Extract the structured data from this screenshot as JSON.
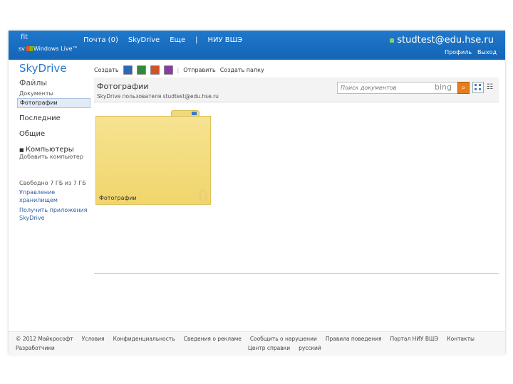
{
  "header": {
    "brand_small": "fit",
    "logo_prefix": "sv",
    "logo_text": "Windows Live",
    "logo_tm": "™",
    "nav": [
      "Почта (0)",
      "SkyDrive",
      "Еще",
      "|",
      "НИУ ВШЭ"
    ],
    "user_email": "studtest@edu.hse.ru",
    "user_links": [
      "Профиль",
      "Выход"
    ]
  },
  "app": {
    "title": "SkyDrive"
  },
  "toolbar": {
    "create_label": "Создать",
    "icons": [
      "word-icon",
      "excel-icon",
      "powerpoint-icon",
      "onenote-icon"
    ],
    "separator": "|",
    "upload_label": "Отправить",
    "create_folder_label": "Создать папку"
  },
  "sidebar": {
    "files_heading": "Файлы",
    "files_items": [
      "Документы",
      "Фотографии"
    ],
    "selected_item": "Фотографии",
    "recent_label": "Последние",
    "shared_label": "Общие",
    "computers_label": "Компьютеры",
    "add_computer_label": "Добавить компьютер",
    "storage_text": "Свободно 7 ГБ из 7 ГБ",
    "manage_storage_label": "Управление хранилищем",
    "get_app_label": "Получить приложения SkyDrive"
  },
  "content": {
    "folder_title": "Фотографии",
    "owner_text": "SkyDrive пользователя studtest@edu.hse.ru",
    "search_placeholder": "Поиск документов",
    "search_brand": "bing",
    "tiles": [
      {
        "name": "Фотографии",
        "count": "0"
      }
    ]
  },
  "footer": {
    "row1": [
      "© 2012 Майкрософт",
      "Условия",
      "Конфиденциальность",
      "Сведения о рекламе",
      "Сообщить о нарушении",
      "Правила поведения",
      "Портал НИУ ВШЭ",
      "Контакты"
    ],
    "row2_left": "Разработчики",
    "row2_right": [
      "Центр справки",
      "русский"
    ]
  },
  "colors": {
    "header_blue": "#1a6fc1",
    "accent_blue": "#2b77c5",
    "folder_yellow": "#f3dc7f",
    "search_orange": "#e57d1c"
  }
}
